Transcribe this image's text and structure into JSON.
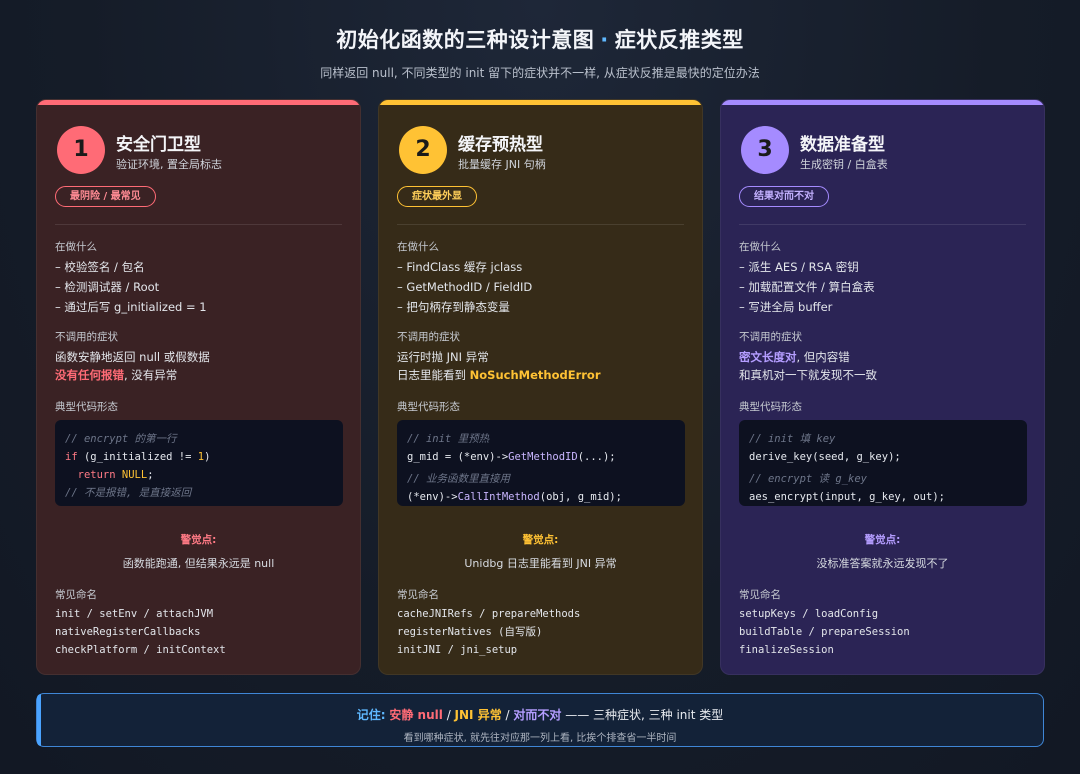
{
  "header": {
    "title_main": "初始化函数的三种设计意图",
    "title_dot": "·",
    "title_tail": "症状反推类型",
    "subtitle": "同样返回 null, 不同类型的 init 留下的症状并不一样, 从症状反推是最快的定位办法"
  },
  "colors": {
    "red": "#ff6b76",
    "yellow": "#ffc234",
    "purple": "#a58bff",
    "blue": "#4aa3ff"
  },
  "cards": [
    {
      "num": "1",
      "title": "安全门卫型",
      "subtitle": "验证环境, 置全局标志",
      "badge": "最阴险 / 最常见",
      "doing_label": "在做什么",
      "doing": [
        "– 校验签名 / 包名",
        "– 检测调试器 / Root",
        "– 通过后写 g_initialized = 1"
      ],
      "symptom_label": "不调用的症状",
      "symptom_line1": "函数安静地返回 null 或假数据",
      "symptom_hl": "没有任何报错",
      "symptom_tail": ", 没有异常",
      "code_label": "典型代码形态",
      "code": {
        "c1": "// encrypt 的第一行",
        "l2_kw": "if",
        "l2_a": " (g_initialized != ",
        "l2_num": "1",
        "l2_b": ")",
        "l3_kw": "  return ",
        "l3_val": "NULL",
        "l3_end": ";",
        "c4": "// 不是报错, 是直接返回"
      },
      "alert_title": "警觉点:",
      "alert_desc": "函数能跑通, 但结果永远是 null",
      "names_label": "常见命名",
      "names": [
        "init / setEnv / attachJVM",
        "nativeRegisterCallbacks",
        "checkPlatform / initContext"
      ]
    },
    {
      "num": "2",
      "title": "缓存预热型",
      "subtitle": "批量缓存 JNI 句柄",
      "badge": "症状最外显",
      "doing_label": "在做什么",
      "doing": [
        "– FindClass 缓存 jclass",
        "– GetMethodID / FieldID",
        "– 把句柄存到静态变量"
      ],
      "symptom_label": "不调用的症状",
      "symptom_line1": "运行时抛 JNI 异常",
      "symptom_pre": "日志里能看到 ",
      "symptom_hl": "NoSuchMethodError",
      "code_label": "典型代码形态",
      "code": {
        "c1": "// init 里预热",
        "l2_a": "g_mid = (*env)->",
        "l2_fn": "GetMethodID",
        "l2_b": "(...);",
        "c3": "// 业务函数里直接用",
        "l4_a": "(*env)->",
        "l4_fn": "CallIntMethod",
        "l4_b": "(obj, g_mid);"
      },
      "alert_title": "警觉点:",
      "alert_desc": "Unidbg 日志里能看到 JNI 异常",
      "names_label": "常见命名",
      "names": [
        "cacheJNIRefs / prepareMethods",
        "registerNatives (自写版)",
        "initJNI / jni_setup"
      ]
    },
    {
      "num": "3",
      "title": "数据准备型",
      "subtitle": "生成密钥 / 白盒表",
      "badge": "结果对而不对",
      "doing_label": "在做什么",
      "doing": [
        "– 派生 AES / RSA 密钥",
        "– 加载配置文件 / 算白盒表",
        "– 写进全局 buffer"
      ],
      "symptom_label": "不调用的症状",
      "symptom_hl": "密文长度对",
      "symptom_tail": ", 但内容错",
      "symptom_line2": "和真机对一下就发现不一致",
      "code_label": "典型代码形态",
      "code": {
        "c1": "// init 填 key",
        "l2": "derive_key(seed, g_key);",
        "c3": "// encrypt 读 g_key",
        "l4": "aes_encrypt(input, g_key, out);"
      },
      "alert_title": "警觉点:",
      "alert_desc": "没标准答案就永远发现不了",
      "names_label": "常见命名",
      "names": [
        "setupKeys / loadConfig",
        "buildTable / prepareSession",
        "finalizeSession"
      ]
    }
  ],
  "footer": {
    "remember": "记住:",
    "s1": "安静 null",
    "sep1": " / ",
    "s2": "JNI 异常",
    "sep2": " / ",
    "s3": "对而不对",
    "tail": " —— 三种症状, 三种 init 类型",
    "sub": "看到哪种症状, 就先往对应那一列上看, 比挨个排查省一半时间"
  }
}
